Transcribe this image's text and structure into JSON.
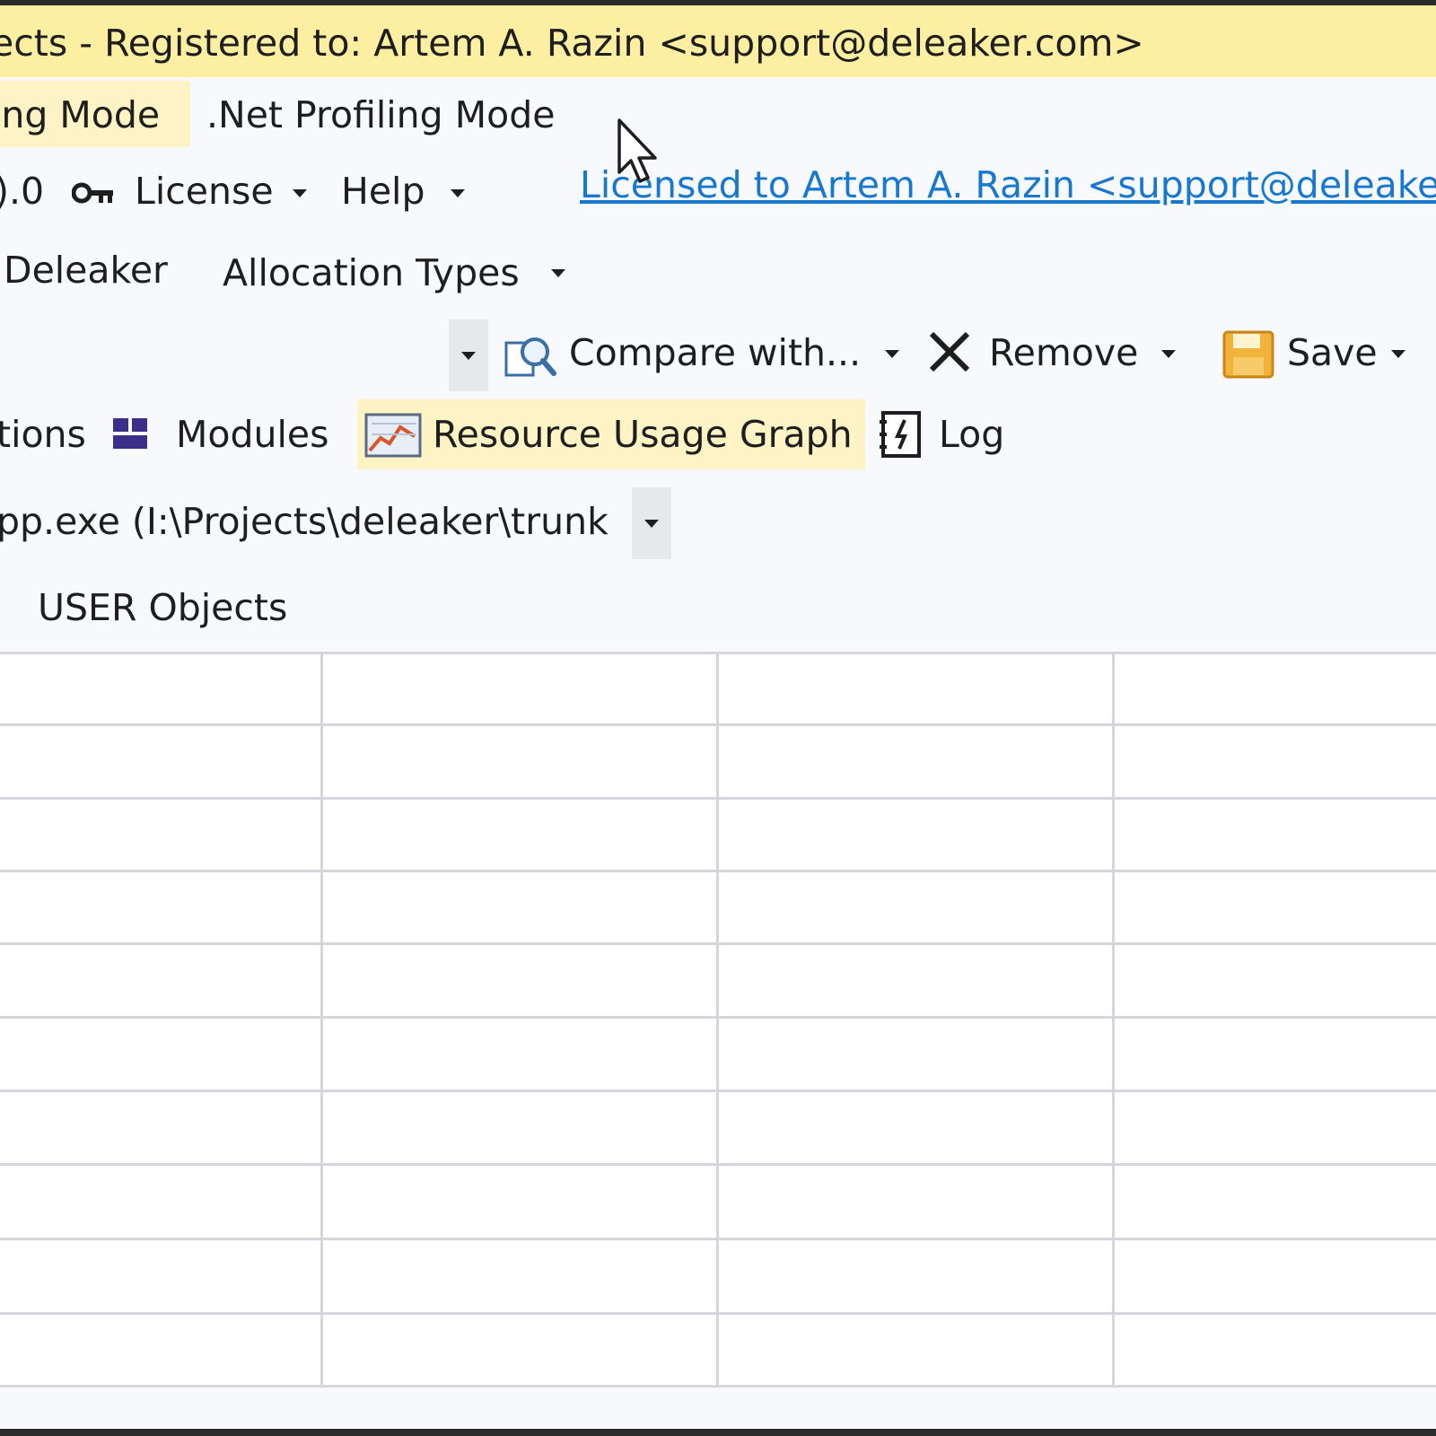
{
  "window": {
    "title": "ects - Registered to: Artem A. Razin <support@deleaker.com>"
  },
  "mode_tabs": [
    {
      "label": "ing Mode",
      "active": true
    },
    {
      "label": ".Net Profiling Mode",
      "active": false
    }
  ],
  "menu": {
    "version_fragment": ").0",
    "license_label": "License",
    "help_label": "Help",
    "licensed_link": "Licensed to Artem A. Razin <support@deleake"
  },
  "toolbar": {
    "deleaker_label": "Deleaker",
    "allocation_types_label": "Allocation Types",
    "compare_label": "Compare with...",
    "remove_label": "Remove",
    "save_label": "Save"
  },
  "view_tabs": [
    {
      "label": "tions",
      "active": false
    },
    {
      "label": "Modules",
      "active": false
    },
    {
      "label": "Resource Usage Graph",
      "active": true
    },
    {
      "label": "Log",
      "active": false
    }
  ],
  "process_selector": {
    "value": "pp.exe (I:\\Projects\\deleaker\\trunk"
  },
  "filter": {
    "user_objects_label": "USER Objects"
  },
  "colors": {
    "title_bar": "#FCEFA1",
    "active_tab": "#FDF3C4",
    "link": "#1878D0",
    "modules_icon": "#3B2F8C",
    "save_icon": "#F2B33A"
  },
  "icons": [
    "key-icon",
    "compare-magnifier-icon",
    "remove-x-icon",
    "save-disk-icon",
    "modules-icon",
    "resource-graph-icon",
    "log-icon",
    "mouse-cursor-icon"
  ]
}
